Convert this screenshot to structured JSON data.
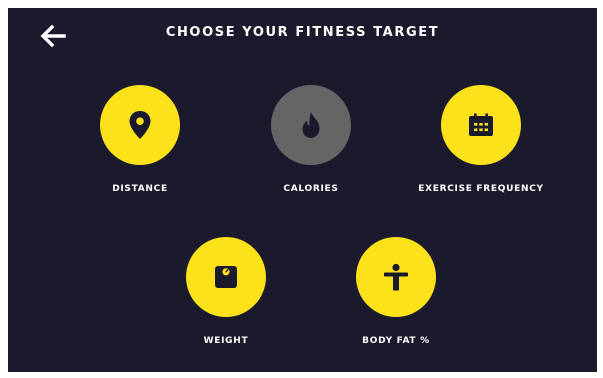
{
  "header": {
    "back_icon": "arrow-left-icon",
    "title": "CHOOSE YOUR FITNESS TARGET"
  },
  "colors": {
    "background": "#1b1a2c",
    "accent": "#fbe21a",
    "disabled": "#666565",
    "text": "#ffffff"
  },
  "targets": [
    {
      "label": "DISTANCE",
      "icon": "map-pin-icon",
      "enabled": true
    },
    {
      "label": "CALORIES",
      "icon": "flame-icon",
      "enabled": false
    },
    {
      "label": "EXERCISE FREQUENCY",
      "icon": "calendar-icon",
      "enabled": true
    },
    {
      "label": "WEIGHT",
      "icon": "scale-icon",
      "enabled": true
    },
    {
      "label": "BODY FAT %",
      "icon": "body-icon",
      "enabled": true
    }
  ]
}
